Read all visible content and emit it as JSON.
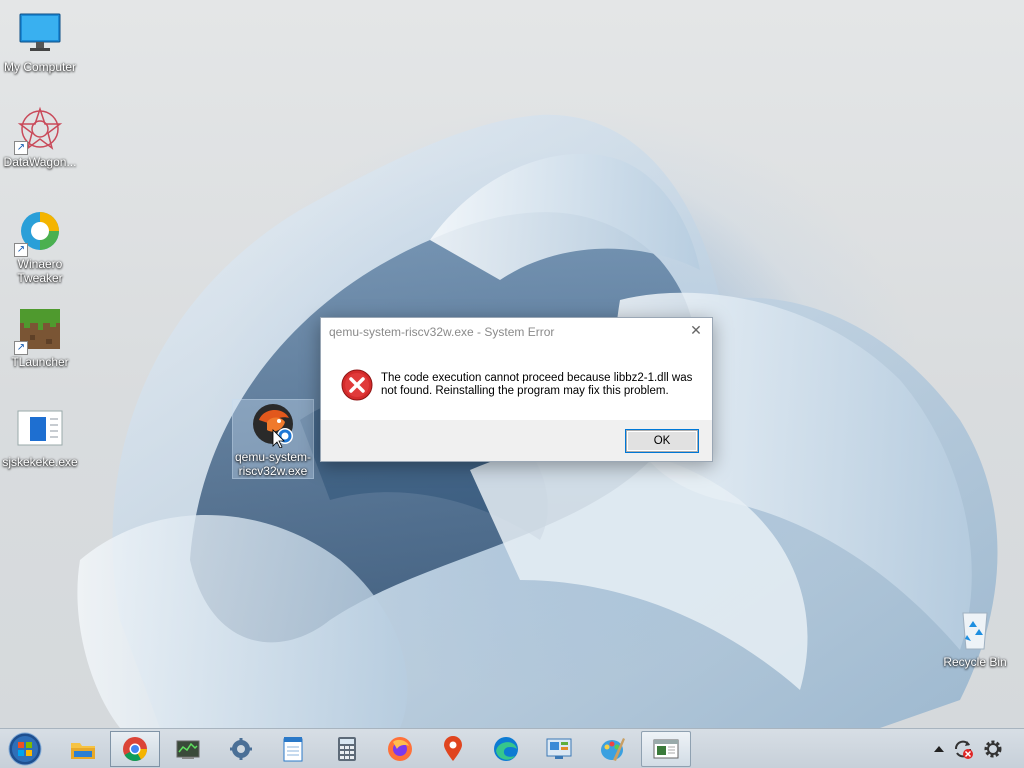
{
  "desktop": {
    "icons": [
      {
        "label": "My Computer",
        "icon": "monitor-icon"
      },
      {
        "label": "DataWagon...",
        "icon": "datawagon-icon"
      },
      {
        "label": "Winaero Tweaker",
        "icon": "winaero-icon"
      },
      {
        "label": "TLauncher",
        "icon": "grass-block-icon"
      },
      {
        "label": "sjskekeke.exe",
        "icon": "exe-window-icon"
      },
      {
        "label": "qemu-system-riscv32w.exe",
        "icon": "qemu-icon"
      },
      {
        "label": "Recycle Bin",
        "icon": "recycle-bin-icon"
      }
    ]
  },
  "dialog": {
    "title": "qemu-system-riscv32w.exe - System Error",
    "close": "✕",
    "message": "The code execution cannot proceed because libbz2-1.dll was not found. Reinstalling the program may fix this problem.",
    "ok_label": "OK"
  },
  "taskbar": {
    "items": [
      "start-orb-icon",
      "file-explorer-icon",
      "chrome-icon",
      "task-manager-icon",
      "settings-gear-icon",
      "notepad-icon",
      "calculator-icon",
      "firefox-icon",
      "maps-pin-icon",
      "edge-icon",
      "control-panel-icon",
      "paint-icon",
      "window-app-icon"
    ],
    "tray": [
      "show-hidden-icons",
      "sync-refresh-icon",
      "gear-icon"
    ]
  },
  "colors": {
    "error_red": "#d42b2b",
    "taskbar": "#cfd8e0",
    "focus_blue": "#0078d7"
  }
}
